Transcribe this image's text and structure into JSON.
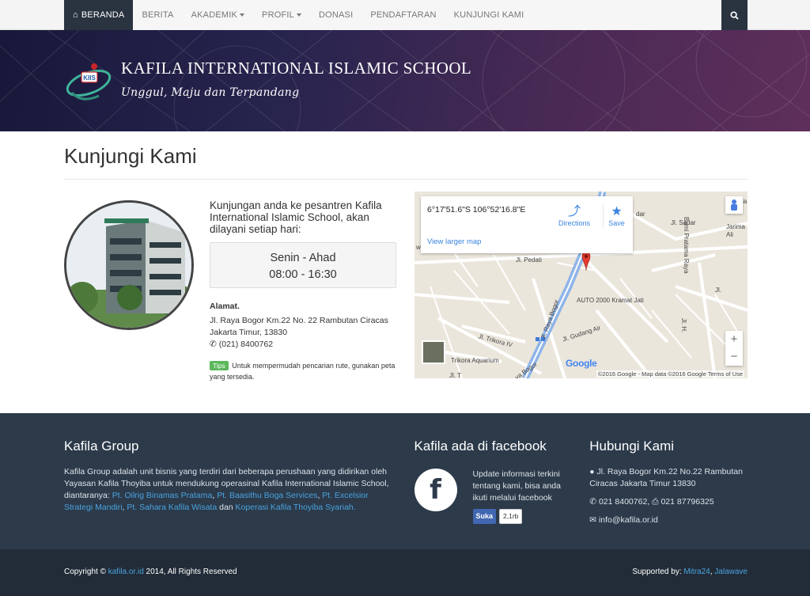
{
  "nav": {
    "items": [
      {
        "label": "BERANDA",
        "active": true,
        "icon": "home-icon"
      },
      {
        "label": "BERITA"
      },
      {
        "label": "AKADEMIK",
        "dropdown": true
      },
      {
        "label": "PROFIL",
        "dropdown": true
      },
      {
        "label": "DONASI"
      },
      {
        "label": "PENDAFTARAN"
      },
      {
        "label": "KUNJUNGI KAMI"
      }
    ],
    "search_icon": "search-icon"
  },
  "header": {
    "school_name": "KAFILA INTERNATIONAL ISLAMIC SCHOOL",
    "tagline": "Unggul, Maju dan Terpandang",
    "logo_text": "KIIS"
  },
  "main": {
    "page_title": "Kunjungi Kami",
    "visit_text": "Kunjungan anda ke pesantren Kafila International Islamic School, akan dilayani setiap hari:",
    "hours_days": "Senin  -  Ahad",
    "hours_time": "08:00  -  16:30",
    "address_title": "Alamat.",
    "address_line1": "Jl. Raya Bogor Km.22 No. 22 Rambutan Ciracas",
    "address_line2": "Jakarta Timur, 13830",
    "phone": "(021) 8400762",
    "tips_label": "Tips",
    "tips_text": "Untuk mempermudah pencarian rute, gunakan peta yang tersedia."
  },
  "map": {
    "coords": "6°17'51.6\"S 106°52'16.8\"E",
    "directions_label": "Directions",
    "save_label": "Save",
    "larger_map_label": "View larger map",
    "zoom_in": "+",
    "zoom_out": "−",
    "google_logo": "Google",
    "attribution": "©2016 Google - Map data ©2016 Google    Terms of Use",
    "labels": {
      "pedati": "Jl. Pedati",
      "auto2000": "AUTO 2000 Kramat Jati",
      "trikora": "Jl. Trikora IV",
      "gudang_air": "Jl. Gudang Air",
      "trikora_aquarium": "Trikora Aquarium",
      "jl_raya_bogor": "Jl. Raya Bogor",
      "jl_sadar": "Jl. Sadar",
      "bumi_pratama": "Bumi Pratama Raya",
      "jl_h": "Jl. H.",
      "jarima": "Jarima",
      "ali": "Ali",
      "na": "Na",
      "dar": "dar",
      "wi": "wi",
      "jl": "Jl.",
      "jl_t": "Jl. T",
      "va_bogor": "va Bogor"
    }
  },
  "footer": {
    "group_title": "Kafila Group",
    "group_text_1": "Kafila Group adalah unit bisnis yang terdiri dari beberapa perushaan yang didirikan oleh Yayasan Kafila Thoyiba untuk mendukung operasinal Kafila International Islamic School, diantaranya: ",
    "group_links": [
      "Pt. Oilrig Binamas Pratama",
      "Pt. Baasithu Boga Services",
      "Pt. Excelsior Strategi Mandiri",
      "Pt. Sahara Kafila Wisata",
      "Koperasi Kafila Thoyiba Syariah."
    ],
    "group_sep": ", ",
    "group_and": " dan ",
    "fb_title": "Kafila ada di facebook",
    "fb_text": "Update informasi terkini tentang kami, bisa anda ikuti melalui facebook",
    "fb_like": "Suka",
    "fb_count": "2,1rb",
    "contact_title": "Hubungi Kami",
    "contact_address": "Jl. Raya Bogor Km.22 No.22 Rambutan Ciracas Jakarta Timur 13830",
    "contact_phone": "021 8400762,",
    "contact_fax": "021 87796325",
    "contact_email": "info@kafila.or.id"
  },
  "copyright": {
    "prefix": "Copyright © ",
    "site": "kafila.or.id",
    "suffix": " 2014, All Rights Reserved",
    "supported_prefix": "Supported by: ",
    "supporter1": "Mitra24",
    "supporter_sep": ", ",
    "supporter2": "Jalawave"
  },
  "colors": {
    "accent": "#2a3440",
    "link": "#4aa3df",
    "footer_bg": "#2c3a4a",
    "tips": "#5cb85c"
  }
}
